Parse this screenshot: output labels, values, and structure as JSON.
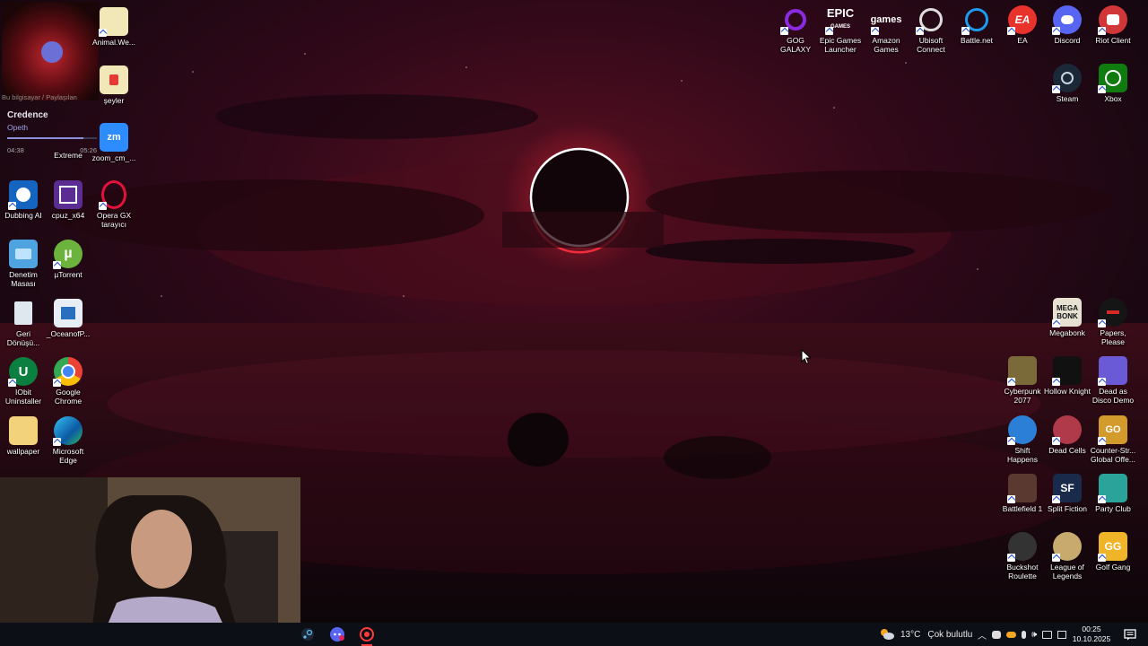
{
  "music_widget": {
    "cover_label": "Bu bilgisayar / Paylaşılan",
    "song": "Credence",
    "artist": "Opeth",
    "elapsed": "04:38",
    "duration": "05:26",
    "progress": 0.85
  },
  "desktop_left": {
    "animal": "Animal.We...",
    "seyler": "şeyler",
    "zoom": "zoom_cm_...",
    "extreme": "Extreme",
    "dubbing": "Dubbing AI",
    "cpuz": "cpuz_x64",
    "opera": "Opera GX tarayıcı",
    "denetim": "Denetim Masası",
    "utorrent": "µTorrent",
    "geri": "Geri Dönüşü...",
    "ocean": "_OceanofP...",
    "iobit": "IObit Uninstaller",
    "chrome": "Google Chrome",
    "wallpaper": "wallpaper",
    "edge": "Microsoft Edge"
  },
  "desktop_right_top": [
    {
      "name": "gog-galaxy",
      "label": "GOG GALAXY"
    },
    {
      "name": "epic-games",
      "label": "Epic Games Launcher"
    },
    {
      "name": "amazon-games",
      "label": "Amazon Games"
    },
    {
      "name": "ubisoft-connect",
      "label": "Ubisoft Connect"
    },
    {
      "name": "battle-net",
      "label": "Battle.net"
    },
    {
      "name": "ea",
      "label": "EA"
    },
    {
      "name": "discord",
      "label": "Discord"
    },
    {
      "name": "riot-client",
      "label": "Riot Client"
    },
    {
      "name": "steam",
      "label": "Steam"
    },
    {
      "name": "xbox",
      "label": "Xbox"
    }
  ],
  "desktop_right_games": [
    {
      "name": "megabonk",
      "label": "Megabonk"
    },
    {
      "name": "papers-please",
      "label": "Papers, Please"
    },
    {
      "name": "cyberpunk",
      "label": "Cyberpunk 2077"
    },
    {
      "name": "hollow-knight",
      "label": "Hollow Knight"
    },
    {
      "name": "dead-as-disco",
      "label": "Dead as Disco Demo"
    },
    {
      "name": "shift-happens",
      "label": "Shift Happens"
    },
    {
      "name": "dead-cells",
      "label": "Dead Cells"
    },
    {
      "name": "csgo",
      "label": "Counter-Str... Global Offe..."
    },
    {
      "name": "battlefield",
      "label": "Battlefield 1"
    },
    {
      "name": "split-fiction",
      "label": "Split Fiction"
    },
    {
      "name": "party-club",
      "label": "Party Club"
    },
    {
      "name": "buckshot",
      "label": "Buckshot Roulette"
    },
    {
      "name": "lol",
      "label": "League of Legends"
    },
    {
      "name": "golf-gang",
      "label": "Golf Gang"
    }
  ],
  "icon_texts": {
    "epic": "EPIC",
    "epic_sub": "GAMES",
    "amazon": "games",
    "ea": "EA",
    "megabonk": "MEGA BONK",
    "go": "GO",
    "gg": "GG",
    "sf": "SF",
    "zm": "zm"
  },
  "taskbar": {
    "weather_temp": "13°C",
    "weather_desc": "Çok bulutlu",
    "time": "00:25",
    "date": "10.10.2025"
  },
  "colors": {
    "taskbar": "#0d0f17",
    "accent": "#6a70d6"
  }
}
